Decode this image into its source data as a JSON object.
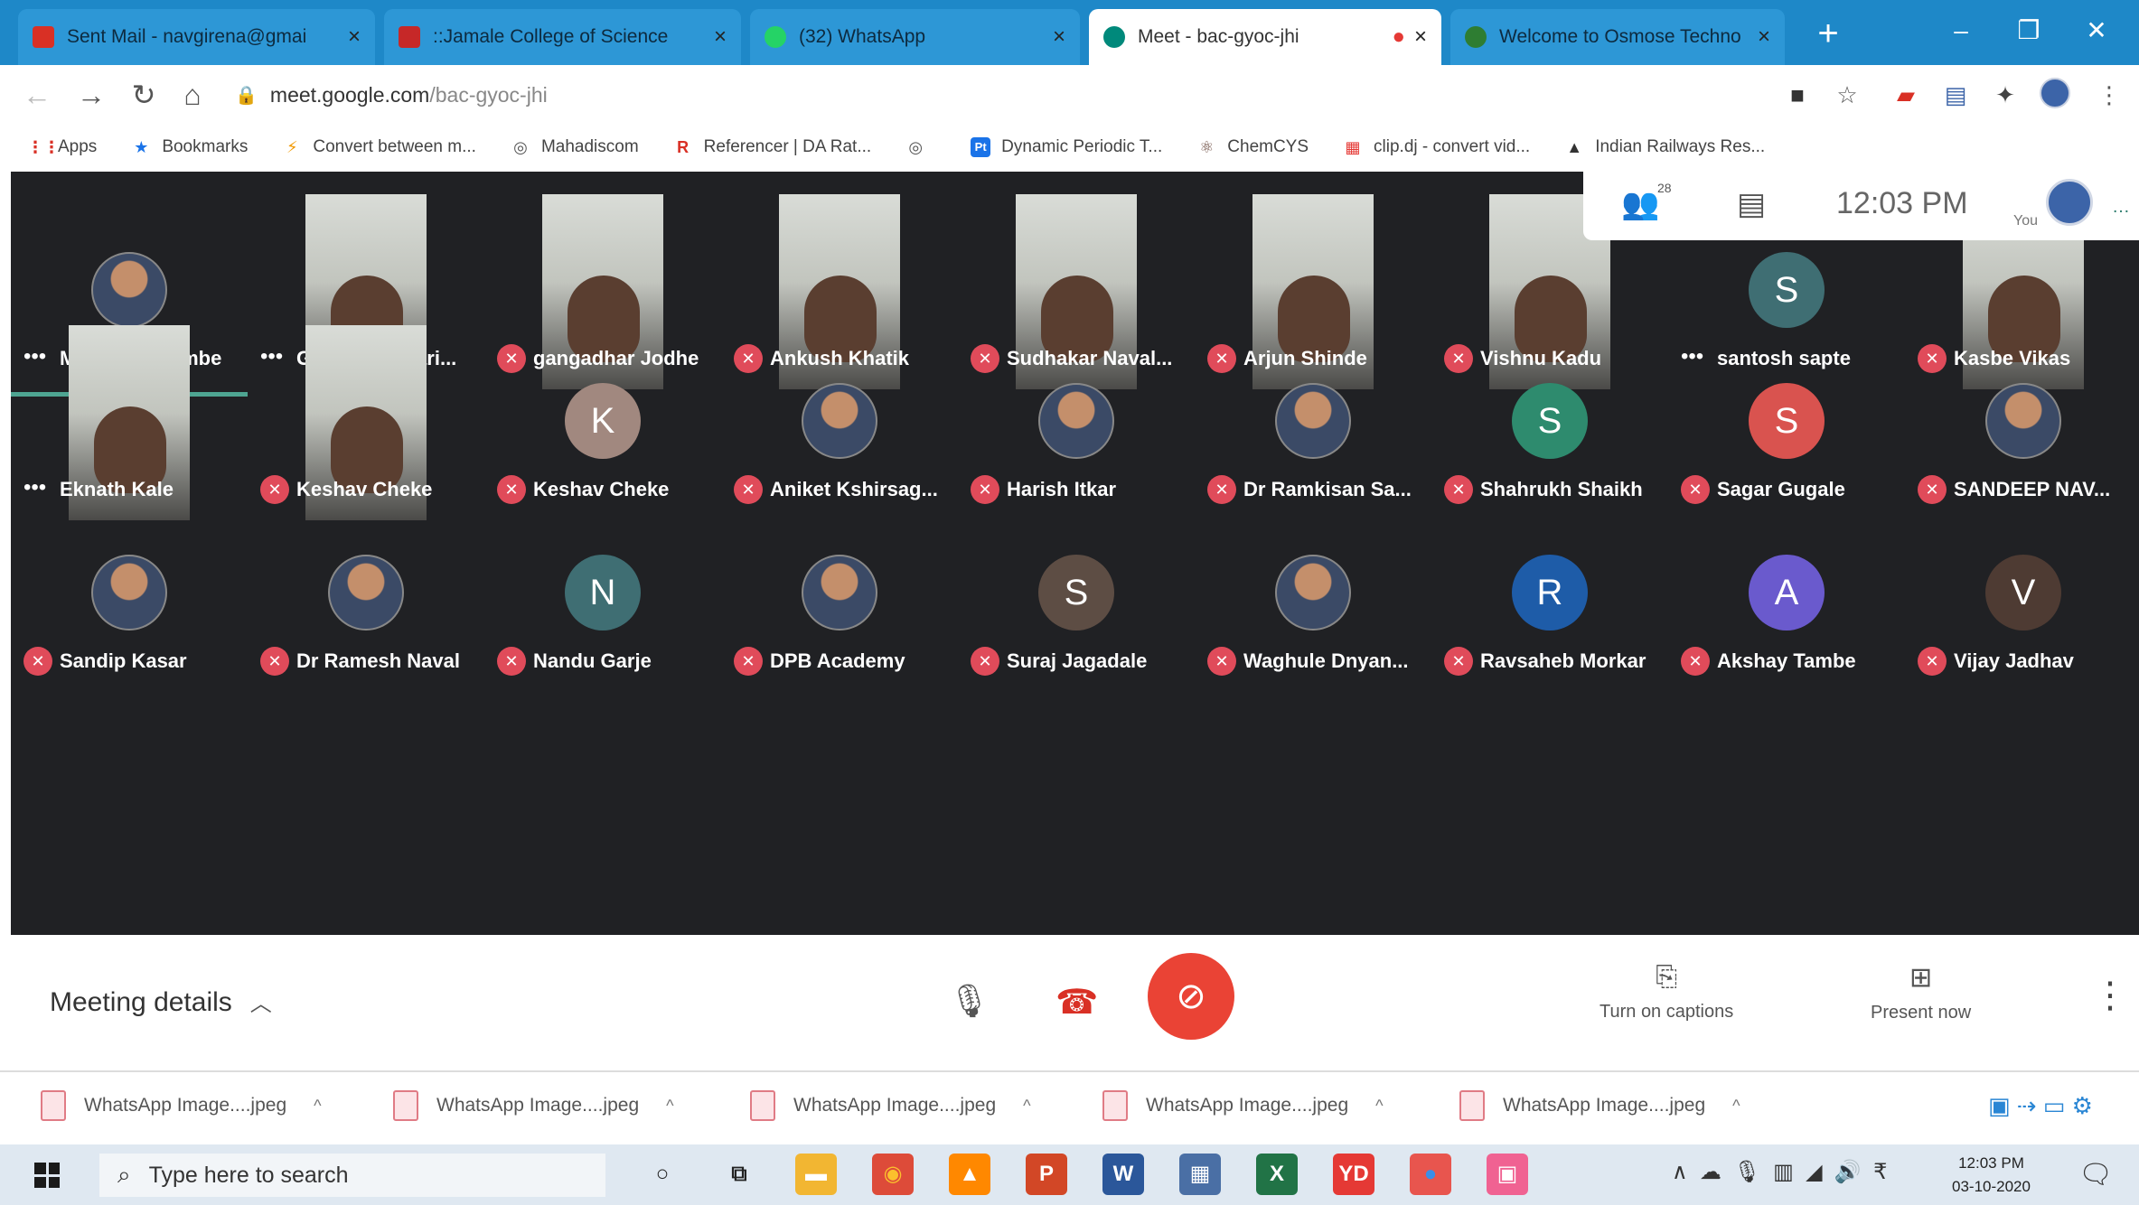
{
  "browser": {
    "tabs": [
      {
        "title": "Sent Mail - navgirena@gmai",
        "favicon": "gmail-icon",
        "color": "#d93025"
      },
      {
        "title": "::Jamale College of Science",
        "favicon": "college-icon",
        "color": "#c62828"
      },
      {
        "title": "(32) WhatsApp",
        "favicon": "whatsapp-icon",
        "color": "#25d366"
      },
      {
        "title": "Meet - bac-gyoc-jhi",
        "favicon": "meet-icon",
        "color": "#00897b",
        "active": true
      },
      {
        "title": "Welcome to Osmose Techno",
        "favicon": "osmose-icon",
        "color": "#2e7d32"
      }
    ],
    "url_host": "meet.google.com",
    "url_path": "/bac-gyoc-jhi",
    "bookmarks": [
      {
        "label": "Apps",
        "icon": "apps-grid-icon",
        "glyph": "⋮⋮",
        "color": "#d93025"
      },
      {
        "label": "Bookmarks",
        "icon": "star-icon",
        "glyph": "★",
        "color": "#1a73e8"
      },
      {
        "label": "Convert between m...",
        "icon": "convert-icon",
        "glyph": "⚡",
        "color": "#f29900"
      },
      {
        "label": "Mahadiscom",
        "icon": "globe-icon",
        "glyph": "◎",
        "color": "#555"
      },
      {
        "label": "Referencer | DA Rat...",
        "icon": "referencer-icon",
        "glyph": "R",
        "color": "#d93025"
      },
      {
        "label": "",
        "icon": "globe-icon",
        "glyph": "◎",
        "color": "#555"
      },
      {
        "label": "Dynamic Periodic T...",
        "icon": "periodic-icon",
        "glyph": "Pt",
        "color": "#1a73e8"
      },
      {
        "label": "ChemCYS",
        "icon": "chemcys-icon",
        "glyph": "⚛",
        "color": "#6d4c41"
      },
      {
        "label": "clip.dj - convert vid...",
        "icon": "clipdj-icon",
        "glyph": "▦",
        "color": "#e53935"
      },
      {
        "label": "Indian Railways Res...",
        "icon": "railways-icon",
        "glyph": "▲",
        "color": "#333"
      }
    ]
  },
  "meet": {
    "participants_count": "28",
    "time": "12:03 PM",
    "self_label": "You",
    "participants": [
      {
        "name": "Mahendra Tambe",
        "kind": "avatar",
        "muted": false,
        "speaking": true
      },
      {
        "name": "Ganeshkanhari...",
        "kind": "video",
        "muted": false
      },
      {
        "name": "gangadhar Jodhe",
        "kind": "video",
        "muted": true
      },
      {
        "name": "Ankush Khatik",
        "kind": "video",
        "muted": true
      },
      {
        "name": "Sudhakar Naval...",
        "kind": "video",
        "muted": true
      },
      {
        "name": "Arjun Shinde",
        "kind": "video",
        "muted": true
      },
      {
        "name": "Vishnu Kadu",
        "kind": "video",
        "muted": true
      },
      {
        "name": "santosh sapte",
        "kind": "letter",
        "letter": "S",
        "color": "#3f6e73",
        "muted": false
      },
      {
        "name": "Kasbe Vikas",
        "kind": "video",
        "muted": true
      },
      {
        "name": "Eknath Kale",
        "kind": "video",
        "muted": false
      },
      {
        "name": "Keshav Cheke",
        "kind": "video",
        "muted": true
      },
      {
        "name": "Keshav Cheke",
        "kind": "letter",
        "letter": "K",
        "color": "#a1887f",
        "muted": true
      },
      {
        "name": "Aniket Kshirsag...",
        "kind": "avatar",
        "muted": true
      },
      {
        "name": "Harish Itkar",
        "kind": "avatar",
        "muted": true
      },
      {
        "name": "Dr Ramkisan Sa...",
        "kind": "avatar",
        "muted": true
      },
      {
        "name": "Shahrukh Shaikh",
        "kind": "letter",
        "letter": "S",
        "color": "#2e8b6e",
        "muted": true
      },
      {
        "name": "Sagar Gugale",
        "kind": "letter",
        "letter": "S",
        "color": "#d9534f",
        "muted": true
      },
      {
        "name": "SANDEEP NAV...",
        "kind": "avatar",
        "muted": true
      },
      {
        "name": "Sandip Kasar",
        "kind": "avatar",
        "muted": true
      },
      {
        "name": "Dr Ramesh Naval",
        "kind": "avatar",
        "muted": true
      },
      {
        "name": "Nandu Garje",
        "kind": "letter",
        "letter": "N",
        "color": "#3f6e73",
        "muted": true
      },
      {
        "name": "DPB Academy",
        "kind": "avatar",
        "muted": true
      },
      {
        "name": "Suraj Jagadale",
        "kind": "letter",
        "letter": "S",
        "color": "#5d4d44",
        "muted": true
      },
      {
        "name": "Waghule Dnyan...",
        "kind": "avatar",
        "muted": true
      },
      {
        "name": "Ravsaheb Morkar",
        "kind": "letter",
        "letter": "R",
        "color": "#1e5ca8",
        "muted": true
      },
      {
        "name": "Akshay Tambe",
        "kind": "letter",
        "letter": "A",
        "color": "#6a5acd",
        "muted": true
      },
      {
        "name": "Vijay Jadhav",
        "kind": "letter",
        "letter": "V",
        "color": "#4e3b33",
        "muted": true
      }
    ]
  },
  "controls": {
    "meeting_details": "Meeting details",
    "captions": "Turn on captions",
    "present": "Present now"
  },
  "downloads": [
    {
      "name": "WhatsApp Image....jpeg"
    },
    {
      "name": "WhatsApp Image....jpeg"
    },
    {
      "name": "WhatsApp Image....jpeg"
    },
    {
      "name": "WhatsApp Image....jpeg"
    },
    {
      "name": "WhatsApp Image....jpeg"
    }
  ],
  "taskbar": {
    "search_placeholder": "Type here to search",
    "time": "12:03 PM",
    "date": "03-10-2020",
    "apps": [
      {
        "icon": "cortana-icon",
        "glyph": "○",
        "color": "#dfe8f1",
        "fg": "#222"
      },
      {
        "icon": "task-view-icon",
        "glyph": "⧉",
        "color": "#dfe8f1",
        "fg": "#222"
      },
      {
        "icon": "file-explorer-icon",
        "glyph": "▬",
        "color": "#f2b632",
        "fg": "#fff"
      },
      {
        "icon": "chrome-icon",
        "glyph": "◉",
        "color": "#dd4b39",
        "fg": "#fbc02d"
      },
      {
        "icon": "vlc-icon",
        "glyph": "▲",
        "color": "#ff8800",
        "fg": "#fff"
      },
      {
        "icon": "powerpoint-icon",
        "glyph": "P",
        "color": "#d24726",
        "fg": "#fff"
      },
      {
        "icon": "word-icon",
        "glyph": "W",
        "color": "#2b579a",
        "fg": "#fff"
      },
      {
        "icon": "calculator-icon",
        "glyph": "▦",
        "color": "#4a6fa5",
        "fg": "#fff"
      },
      {
        "icon": "excel-icon",
        "glyph": "X",
        "color": "#217346",
        "fg": "#fff"
      },
      {
        "icon": "youtube-downloader-icon",
        "glyph": "YD",
        "color": "#e53935",
        "fg": "#fff"
      },
      {
        "icon": "paint-icon",
        "glyph": "●",
        "color": "#e8554e",
        "fg": "#3b8ee8"
      },
      {
        "icon": "image-viewer-icon",
        "glyph": "▣",
        "color": "#f06292",
        "fg": "#fff"
      }
    ]
  }
}
